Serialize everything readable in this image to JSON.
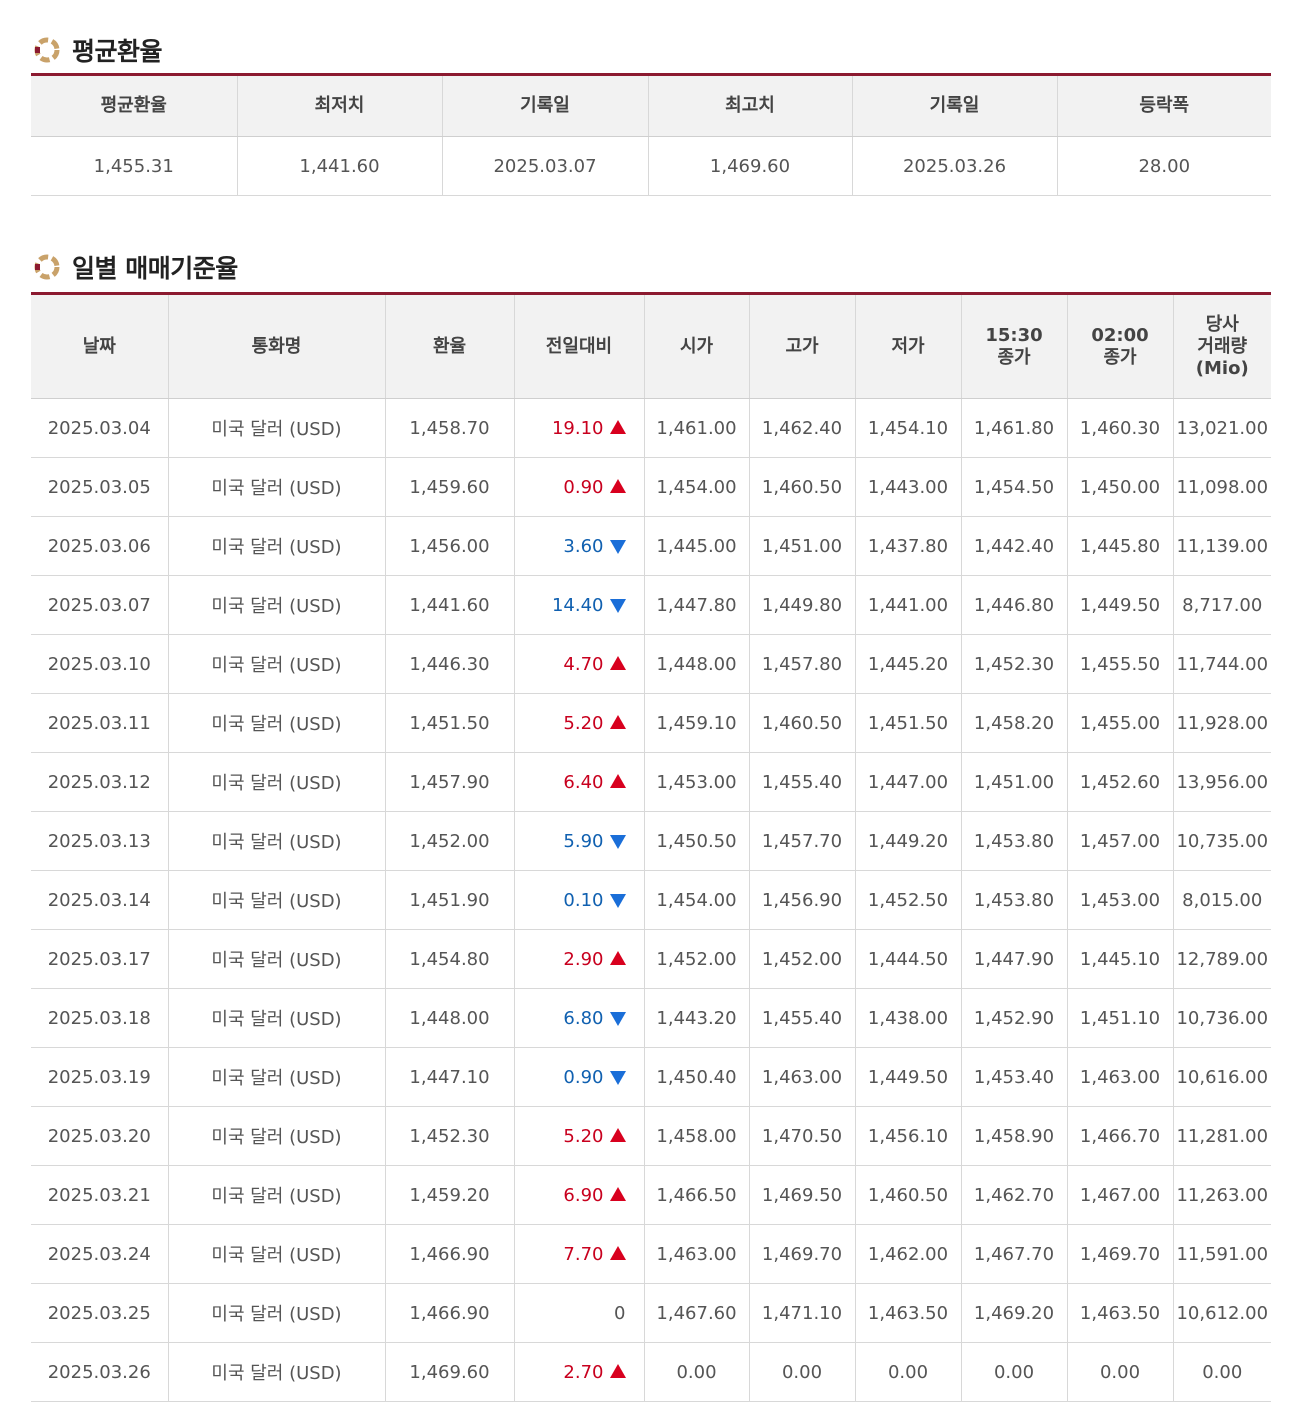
{
  "avg_section": {
    "title": "평균환율",
    "headers": [
      "평균환율",
      "최저치",
      "기록일",
      "최고치",
      "기록일",
      "등락폭"
    ],
    "values": [
      "1,455.31",
      "1,441.60",
      "2025.03.07",
      "1,469.60",
      "2025.03.26",
      "28.00"
    ]
  },
  "daily_section": {
    "title": "일별 매매기준율",
    "headers": {
      "date": "날짜",
      "currency": "통화명",
      "rate": "환율",
      "change": "전일대비",
      "open": "시가",
      "high": "고가",
      "low": "저가",
      "close1530_time": "15:30",
      "close1530_label": "종가",
      "close0200_time": "02:00",
      "close0200_label": "종가",
      "volume_l1": "당사",
      "volume_l2": "거래량",
      "volume_l3": "(Mio)"
    },
    "rows": [
      {
        "date": "2025.03.04",
        "currency": "미국 달러 (USD)",
        "rate": "1,458.70",
        "change": "19.10",
        "dir": "up",
        "open": "1,461.00",
        "high": "1,462.40",
        "low": "1,454.10",
        "close1530": "1,461.80",
        "close0200": "1,460.30",
        "volume": "13,021.00"
      },
      {
        "date": "2025.03.05",
        "currency": "미국 달러 (USD)",
        "rate": "1,459.60",
        "change": "0.90",
        "dir": "up",
        "open": "1,454.00",
        "high": "1,460.50",
        "low": "1,443.00",
        "close1530": "1,454.50",
        "close0200": "1,450.00",
        "volume": "11,098.00"
      },
      {
        "date": "2025.03.06",
        "currency": "미국 달러 (USD)",
        "rate": "1,456.00",
        "change": "3.60",
        "dir": "down",
        "open": "1,445.00",
        "high": "1,451.00",
        "low": "1,437.80",
        "close1530": "1,442.40",
        "close0200": "1,445.80",
        "volume": "11,139.00"
      },
      {
        "date": "2025.03.07",
        "currency": "미국 달러 (USD)",
        "rate": "1,441.60",
        "change": "14.40",
        "dir": "down",
        "open": "1,447.80",
        "high": "1,449.80",
        "low": "1,441.00",
        "close1530": "1,446.80",
        "close0200": "1,449.50",
        "volume": "8,717.00"
      },
      {
        "date": "2025.03.10",
        "currency": "미국 달러 (USD)",
        "rate": "1,446.30",
        "change": "4.70",
        "dir": "up",
        "open": "1,448.00",
        "high": "1,457.80",
        "low": "1,445.20",
        "close1530": "1,452.30",
        "close0200": "1,455.50",
        "volume": "11,744.00"
      },
      {
        "date": "2025.03.11",
        "currency": "미국 달러 (USD)",
        "rate": "1,451.50",
        "change": "5.20",
        "dir": "up",
        "open": "1,459.10",
        "high": "1,460.50",
        "low": "1,451.50",
        "close1530": "1,458.20",
        "close0200": "1,455.00",
        "volume": "11,928.00"
      },
      {
        "date": "2025.03.12",
        "currency": "미국 달러 (USD)",
        "rate": "1,457.90",
        "change": "6.40",
        "dir": "up",
        "open": "1,453.00",
        "high": "1,455.40",
        "low": "1,447.00",
        "close1530": "1,451.00",
        "close0200": "1,452.60",
        "volume": "13,956.00"
      },
      {
        "date": "2025.03.13",
        "currency": "미국 달러 (USD)",
        "rate": "1,452.00",
        "change": "5.90",
        "dir": "down",
        "open": "1,450.50",
        "high": "1,457.70",
        "low": "1,449.20",
        "close1530": "1,453.80",
        "close0200": "1,457.00",
        "volume": "10,735.00"
      },
      {
        "date": "2025.03.14",
        "currency": "미국 달러 (USD)",
        "rate": "1,451.90",
        "change": "0.10",
        "dir": "down",
        "open": "1,454.00",
        "high": "1,456.90",
        "low": "1,452.50",
        "close1530": "1,453.80",
        "close0200": "1,453.00",
        "volume": "8,015.00"
      },
      {
        "date": "2025.03.17",
        "currency": "미국 달러 (USD)",
        "rate": "1,454.80",
        "change": "2.90",
        "dir": "up",
        "open": "1,452.00",
        "high": "1,452.00",
        "low": "1,444.50",
        "close1530": "1,447.90",
        "close0200": "1,445.10",
        "volume": "12,789.00"
      },
      {
        "date": "2025.03.18",
        "currency": "미국 달러 (USD)",
        "rate": "1,448.00",
        "change": "6.80",
        "dir": "down",
        "open": "1,443.20",
        "high": "1,455.40",
        "low": "1,438.00",
        "close1530": "1,452.90",
        "close0200": "1,451.10",
        "volume": "10,736.00"
      },
      {
        "date": "2025.03.19",
        "currency": "미국 달러 (USD)",
        "rate": "1,447.10",
        "change": "0.90",
        "dir": "down",
        "open": "1,450.40",
        "high": "1,463.00",
        "low": "1,449.50",
        "close1530": "1,453.40",
        "close0200": "1,463.00",
        "volume": "10,616.00"
      },
      {
        "date": "2025.03.20",
        "currency": "미국 달러 (USD)",
        "rate": "1,452.30",
        "change": "5.20",
        "dir": "up",
        "open": "1,458.00",
        "high": "1,470.50",
        "low": "1,456.10",
        "close1530": "1,458.90",
        "close0200": "1,466.70",
        "volume": "11,281.00"
      },
      {
        "date": "2025.03.21",
        "currency": "미국 달러 (USD)",
        "rate": "1,459.20",
        "change": "6.90",
        "dir": "up",
        "open": "1,466.50",
        "high": "1,469.50",
        "low": "1,460.50",
        "close1530": "1,462.70",
        "close0200": "1,467.00",
        "volume": "11,263.00"
      },
      {
        "date": "2025.03.24",
        "currency": "미국 달러 (USD)",
        "rate": "1,466.90",
        "change": "7.70",
        "dir": "up",
        "open": "1,463.00",
        "high": "1,469.70",
        "low": "1,462.00",
        "close1530": "1,467.70",
        "close0200": "1,469.70",
        "volume": "11,591.00"
      },
      {
        "date": "2025.03.25",
        "currency": "미국 달러 (USD)",
        "rate": "1,466.90",
        "change": "0",
        "dir": "flat",
        "open": "1,467.60",
        "high": "1,471.10",
        "low": "1,463.50",
        "close1530": "1,469.20",
        "close0200": "1,463.50",
        "volume": "10,612.00"
      },
      {
        "date": "2025.03.26",
        "currency": "미국 달러 (USD)",
        "rate": "1,469.60",
        "change": "2.70",
        "dir": "up",
        "open": "0.00",
        "high": "0.00",
        "low": "0.00",
        "close1530": "0.00",
        "close0200": "0.00",
        "volume": "0.00"
      }
    ]
  },
  "colors": {
    "accent_border": "#8c1a30",
    "up": "#c8001e",
    "down": "#1060b0",
    "header_bg": "#f2f2f2"
  },
  "icons": {
    "section_bullet": "ring-bullet-icon",
    "up": "triangle-up-icon",
    "down": "triangle-down-icon"
  }
}
